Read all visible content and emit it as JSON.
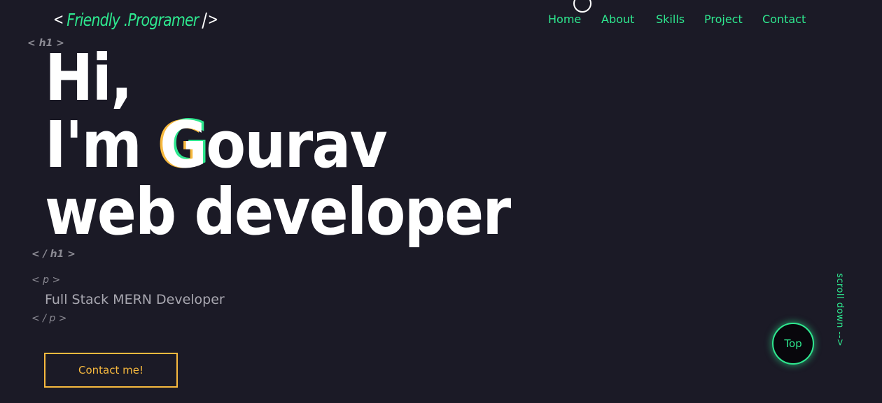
{
  "colors": {
    "background": "#1b1a26",
    "accent_green": "#2ee88f",
    "accent_orange": "#f7b93e",
    "text_white": "#ffffff",
    "tag_gray": "#8b8a93"
  },
  "logo": {
    "open_bracket": "<",
    "text": "Friendly .Programer",
    "slash": "/",
    "close_bracket": ">"
  },
  "nav": {
    "items": [
      {
        "label": "Home"
      },
      {
        "label": "About"
      },
      {
        "label": "Skills"
      },
      {
        "label": "Project"
      },
      {
        "label": "Contact"
      }
    ]
  },
  "hero": {
    "h1_open_tag": "< h1 >",
    "h1_close_tag": "< / h1 >",
    "line1": "Hi,",
    "line2_prefix": "I'm ",
    "line2_highlight": "G",
    "line2_suffix": "ourav",
    "line3": "web developer",
    "p_open_tag": "< p >",
    "p_close_tag": "< / p >",
    "subtitle": "Full Stack MERN Developer",
    "contact_button": "Contact me!"
  },
  "side": {
    "scroll_down": "scroll down -->",
    "top_button": "Top"
  }
}
